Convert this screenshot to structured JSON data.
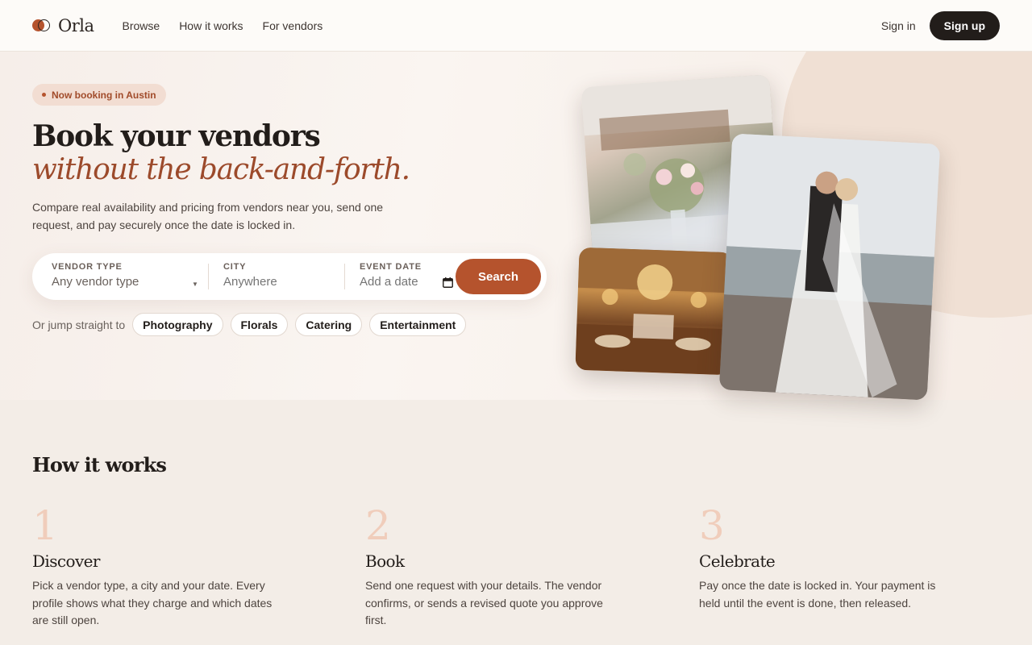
{
  "brand": {
    "name": "Orla",
    "accent": "#b5532d"
  },
  "nav": {
    "items": [
      "Browse",
      "How it works",
      "For vendors"
    ]
  },
  "auth": {
    "sign_in": "Sign in",
    "sign_up": "Sign up"
  },
  "hero": {
    "badge": "Now booking in Austin",
    "title_line1": "Book your vendors",
    "title_line2": "without the back-and-forth.",
    "lede": "Compare real availability and pricing from vendors near you, send one request, and pay securely once the date is locked in."
  },
  "search": {
    "vendor_type_label": "VENDOR TYPE",
    "vendor_type_value": "Any vendor type",
    "city_label": "CITY",
    "city_placeholder": "Anywhere",
    "date_label": "EVENT DATE",
    "date_placeholder": "Add a date",
    "button": "Search"
  },
  "quick_links": {
    "label": "Or jump straight to",
    "chips": [
      "Photography",
      "Florals",
      "Catering",
      "Entertainment"
    ]
  },
  "how": {
    "title": "How it works",
    "steps": [
      {
        "num": "1",
        "title": "Discover",
        "desc": "Pick a vendor type, a city and your date. Every profile shows what they charge and which dates are still open."
      },
      {
        "num": "2",
        "title": "Book",
        "desc": "Send one request with your details. The vendor confirms, or sends a revised quote you approve first."
      },
      {
        "num": "3",
        "title": "Celebrate",
        "desc": "Pay once the date is locked in. Your payment is held until the event is done, then released."
      }
    ]
  }
}
